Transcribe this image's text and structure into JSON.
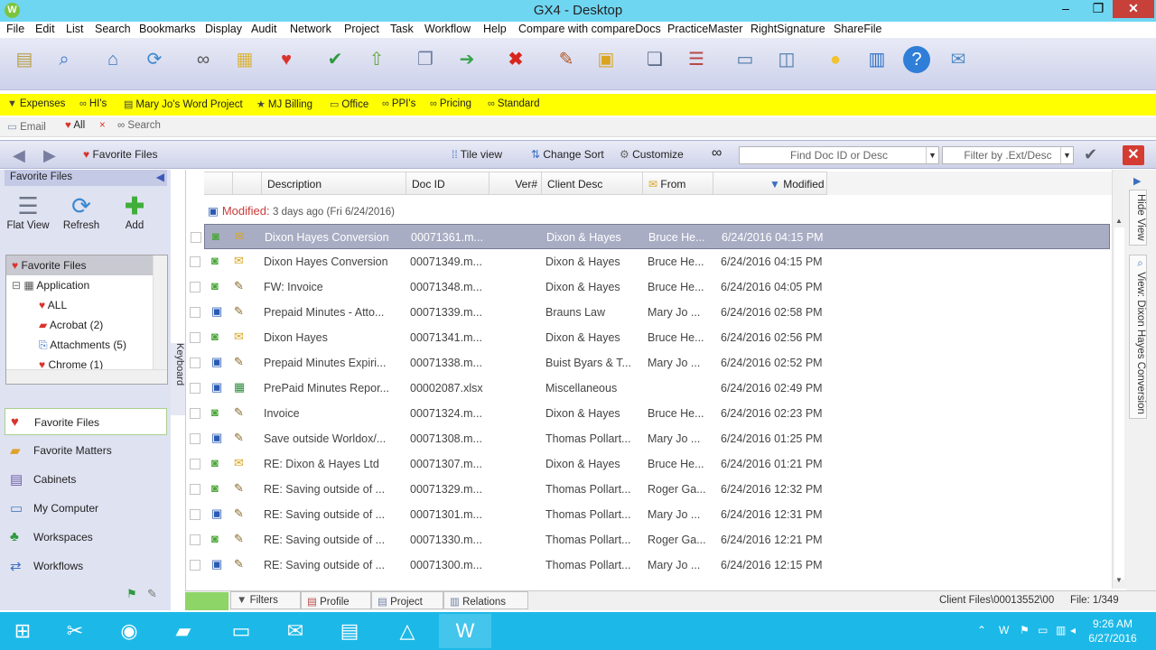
{
  "window": {
    "title": "GX4 - Desktop",
    "app_icon": "W",
    "minimize": "‒",
    "restore": "❐",
    "close": "✕"
  },
  "menu": [
    "File",
    "Edit",
    "List",
    "Search",
    "Bookmarks",
    "Display",
    "Audit",
    "Network",
    "Project",
    "Task",
    "Workflow",
    "Help",
    "Compare with compareDocs",
    "PracticeMaster",
    "RightSignature",
    "ShareFile"
  ],
  "toolbar_icons": [
    "new-document-icon",
    "search-icon",
    "home-icon",
    "refresh-icon",
    "binoculars-icon",
    "favorites-folder-icon",
    "favorite-icon",
    "check-in-icon",
    "upload-icon",
    "copy-icon",
    "export-icon",
    "delete-icon",
    "edit-icon",
    "lock-icon",
    "version-icon",
    "report-icon",
    "profile-icon",
    "view-icon",
    "tip-icon",
    "stack-icon",
    "help-icon",
    "email-icon"
  ],
  "shortcuts": [
    "Expenses",
    "HI's",
    "Mary Jo's Word Project",
    "MJ Billing",
    "Office",
    "PPI's",
    "Pricing",
    "Standard"
  ],
  "tabs": {
    "email": "Email",
    "all": "All",
    "search": "Search"
  },
  "nav": {
    "breadcrumb": "Favorite Files",
    "tile_view": "Tile view",
    "change_sort": "Change Sort",
    "customize": "Customize",
    "find_placeholder": "Find Doc ID or Desc",
    "filter_placeholder": "Filter by .Ext/Desc"
  },
  "left": {
    "header": "Favorite Files",
    "actions": {
      "flat_view": "Flat View",
      "refresh": "Refresh",
      "add": "Add"
    },
    "tree": [
      {
        "label": "Favorite Files"
      },
      {
        "label": "Application"
      },
      {
        "label": "ALL"
      },
      {
        "label": "Acrobat (2)"
      },
      {
        "label": "Attachments (5)"
      },
      {
        "label": "Chrome (1)"
      }
    ],
    "keyboard_tab": "Keyboard",
    "nav_items": [
      "Favorite Files",
      "Favorite Matters",
      "Cabinets",
      "My Computer",
      "Workspaces",
      "Workflows"
    ]
  },
  "grid": {
    "columns": {
      "description": "Description",
      "doc_id": "Doc ID",
      "ver": "Ver#",
      "client": "Client Desc",
      "from": "From",
      "modified": "Modified"
    },
    "group": {
      "label": "Modified:",
      "detail": "3 days ago  (Fri 6/24/2016)"
    },
    "rows": [
      {
        "desc": "Dixon Hayes Conversion",
        "docid": "00071361.m...",
        "client": "Dixon & Hayes",
        "from": "Bruce He...",
        "modified": "6/24/2016 04:15 PM"
      },
      {
        "desc": "Dixon Hayes Conversion",
        "docid": "00071349.m...",
        "client": "Dixon & Hayes",
        "from": "Bruce He...",
        "modified": "6/24/2016 04:15 PM"
      },
      {
        "desc": "FW: Invoice",
        "docid": "00071348.m...",
        "client": "Dixon & Hayes",
        "from": "Bruce He...",
        "modified": "6/24/2016 04:05 PM"
      },
      {
        "desc": "Prepaid Minutes - Atto...",
        "docid": "00071339.m...",
        "client": "Brauns Law",
        "from": "Mary Jo ...",
        "modified": "6/24/2016 02:58 PM"
      },
      {
        "desc": "Dixon Hayes",
        "docid": "00071341.m...",
        "client": "Dixon & Hayes",
        "from": "Bruce He...",
        "modified": "6/24/2016 02:56 PM"
      },
      {
        "desc": "Prepaid Minutes Expiri...",
        "docid": "00071338.m...",
        "client": "Buist Byars & T...",
        "from": "Mary Jo ...",
        "modified": "6/24/2016 02:52 PM"
      },
      {
        "desc": "PrePaid Minutes Repor...",
        "docid": "00002087.xlsx",
        "client": "Miscellaneous",
        "from": "",
        "modified": "6/24/2016 02:49 PM"
      },
      {
        "desc": "Invoice",
        "docid": "00071324.m...",
        "client": "Dixon & Hayes",
        "from": "Bruce He...",
        "modified": "6/24/2016 02:23 PM"
      },
      {
        "desc": "Save outside Worldox/...",
        "docid": "00071308.m...",
        "client": "Thomas Pollart...",
        "from": "Mary Jo ...",
        "modified": "6/24/2016 01:25 PM"
      },
      {
        "desc": "RE: Dixon & Hayes  Ltd",
        "docid": "00071307.m...",
        "client": "Dixon & Hayes",
        "from": "Bruce He...",
        "modified": "6/24/2016 01:21 PM"
      },
      {
        "desc": "RE: Saving outside of ...",
        "docid": "00071329.m...",
        "client": "Thomas Pollart...",
        "from": "Roger Ga...",
        "modified": "6/24/2016 12:32 PM"
      },
      {
        "desc": "RE: Saving outside of ...",
        "docid": "00071301.m...",
        "client": "Thomas Pollart...",
        "from": "Mary Jo ...",
        "modified": "6/24/2016 12:31 PM"
      },
      {
        "desc": "RE: Saving outside of ...",
        "docid": "00071330.m...",
        "client": "Thomas Pollart...",
        "from": "Roger Ga...",
        "modified": "6/24/2016 12:21 PM"
      },
      {
        "desc": "RE: Saving outside of ...",
        "docid": "00071300.m...",
        "client": "Thomas Pollart...",
        "from": "Mary Jo ...",
        "modified": "6/24/2016 12:15 PM"
      }
    ]
  },
  "right_tabs": {
    "hide_view": "Hide View",
    "view": "View: Dixon Hayes Conversion"
  },
  "bottom": {
    "tabs": [
      "Filters",
      "Profile",
      "Project",
      "Relations"
    ],
    "path": "Client Files\\00013552\\00",
    "file_count": "File:  1/349"
  },
  "taskbar": {
    "time": "9:26 AM",
    "date": "6/27/2016"
  }
}
